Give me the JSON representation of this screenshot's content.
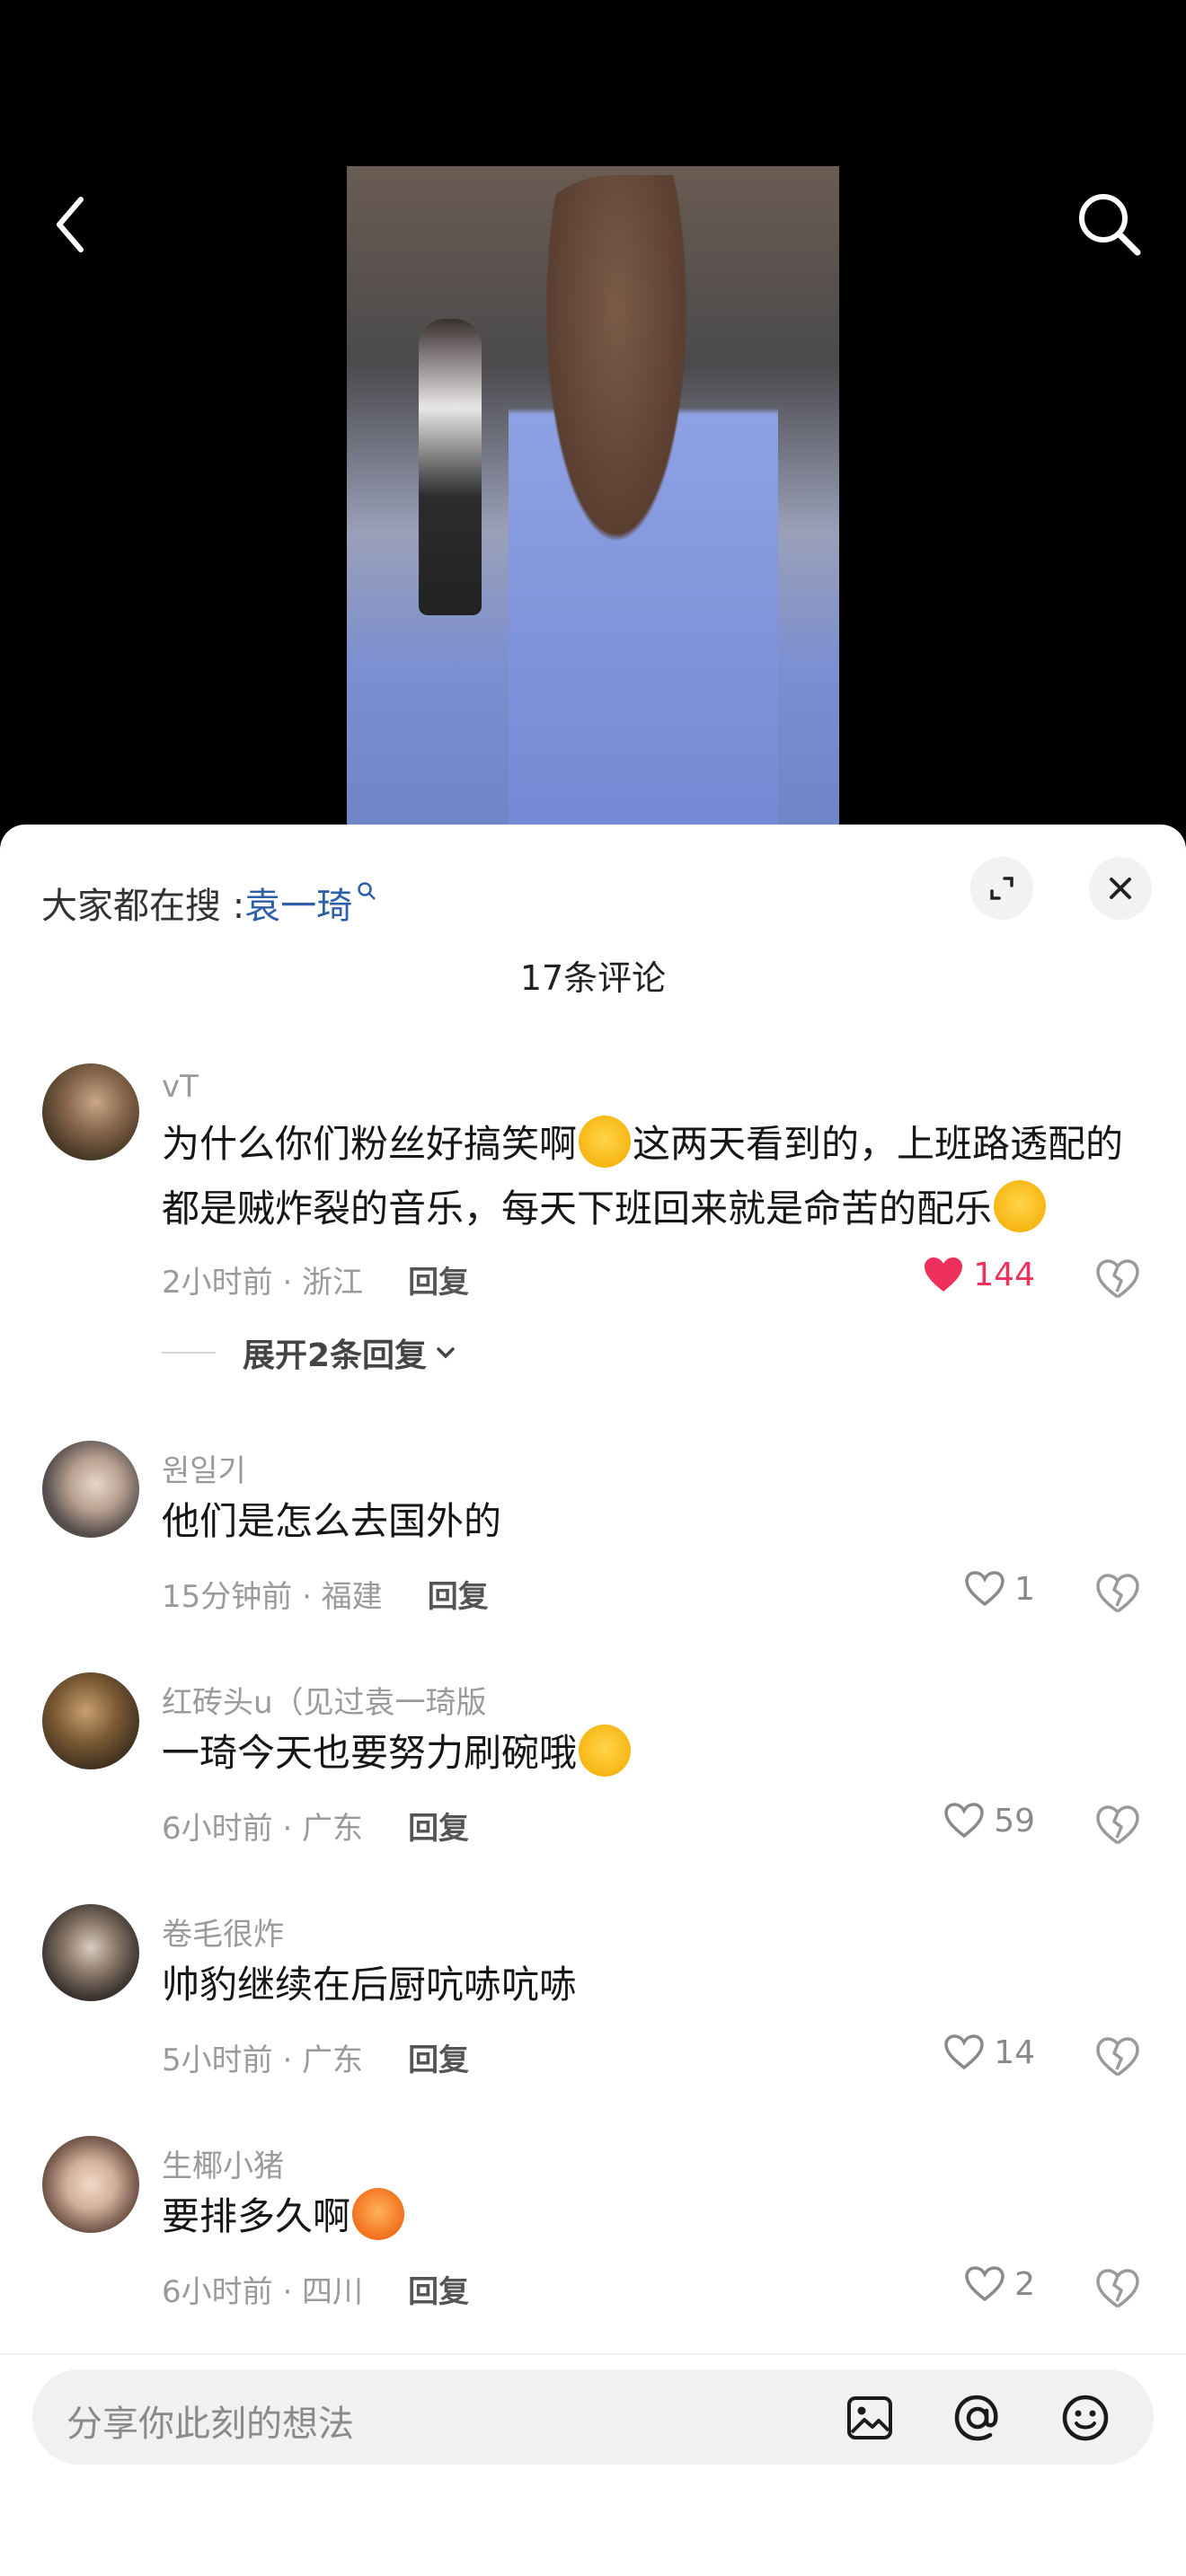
{
  "header": {
    "back_icon": "chevron-left-icon",
    "search_icon": "search-icon"
  },
  "panel": {
    "hot_search_prefix": "大家都在搜 : ",
    "hot_search_term": "袁一琦",
    "comment_count_label": "17条评论"
  },
  "comments": [
    {
      "username": "vT",
      "text_part1": "为什么你们粉丝好搞笑啊",
      "text_part2": "这两天看到的，上班路透配的都是贼炸裂的音乐，每天下班回来就是命苦的配乐",
      "meta": "2小时前 · 浙江",
      "reply": "回复",
      "likes": "144",
      "liked": true,
      "expand_replies": "展开2条回复"
    },
    {
      "username": "원일기",
      "text": "他们是怎么去国外的",
      "meta": "15分钟前 · 福建",
      "reply": "回复",
      "likes": "1"
    },
    {
      "username": "红砖头u（见过袁一琦版",
      "text": "一琦今天也要努力刷碗哦",
      "meta": "6小时前 · 广东",
      "reply": "回复",
      "likes": "59"
    },
    {
      "username": "卷毛很炸",
      "text": "帅豹继续在后厨吭哧吭哧",
      "meta": "5小时前 · 广东",
      "reply": "回复",
      "likes": "14"
    },
    {
      "username": "生椰小猪",
      "text": "要排多久啊",
      "meta": "6小时前 · 四川",
      "reply": "回复",
      "likes": "2"
    }
  ],
  "input": {
    "placeholder": "分享你此刻的想法",
    "icons": [
      "image-icon",
      "at-icon",
      "emoji-icon"
    ]
  },
  "colors": {
    "like_active": "#f0305c",
    "link": "#2d5ea8"
  }
}
